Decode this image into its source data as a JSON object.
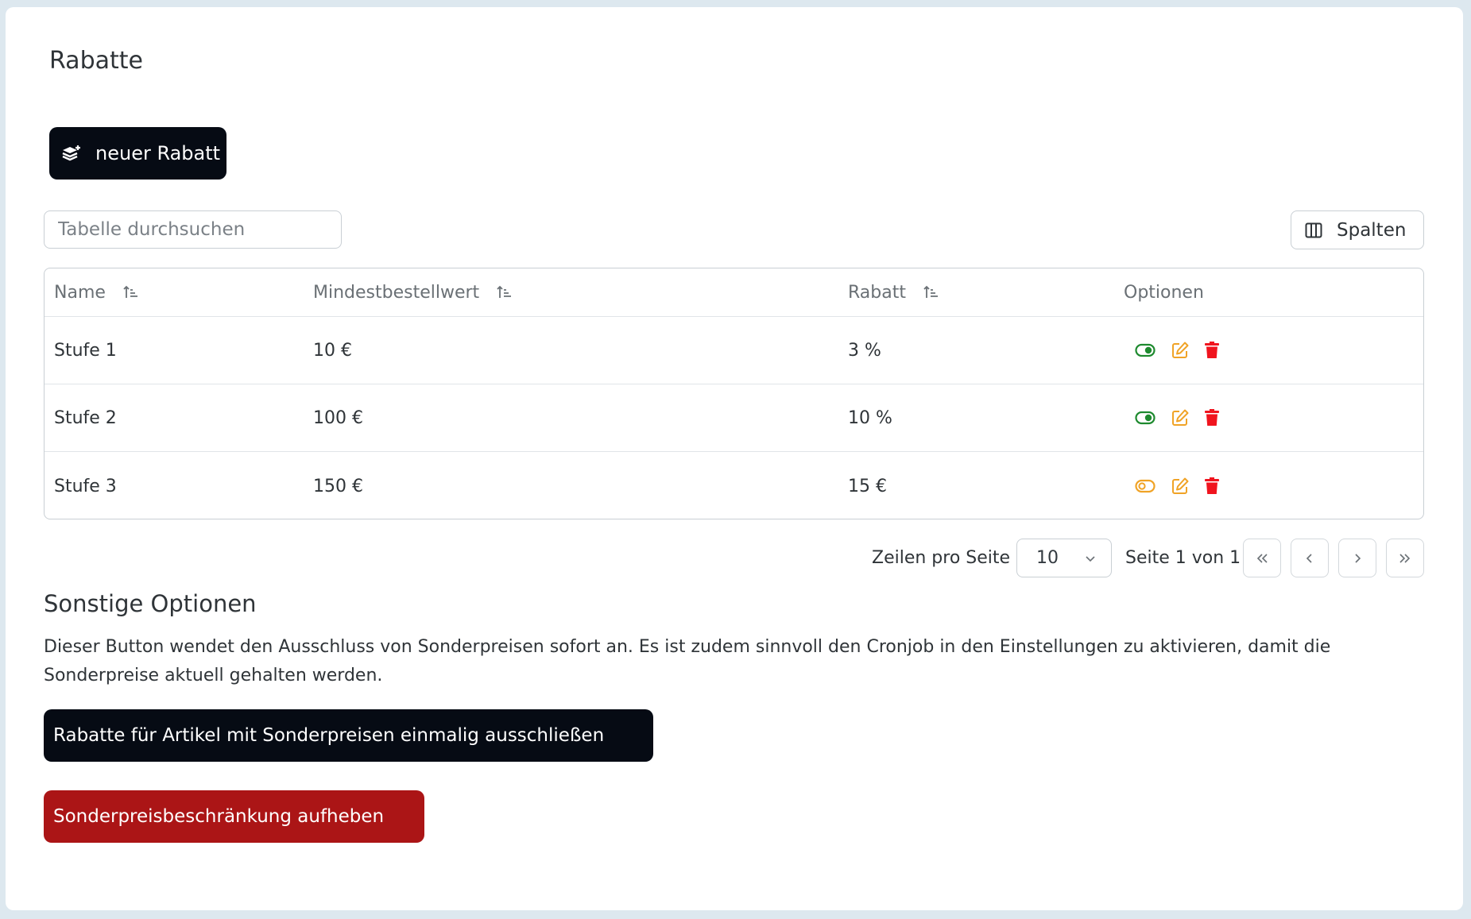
{
  "page": {
    "title": "Rabatte"
  },
  "toolbar": {
    "new_label": "neuer Rabatt",
    "columns_label": "Spalten"
  },
  "search": {
    "placeholder": "Tabelle durchsuchen",
    "value": ""
  },
  "table": {
    "headers": [
      "Name",
      "Mindestbestellwert",
      "Rabatt",
      "Optionen"
    ],
    "rows": [
      {
        "name": "Stufe 1",
        "min_order": "10 €",
        "discount": "3 %",
        "active": true
      },
      {
        "name": "Stufe 2",
        "min_order": "100 €",
        "discount": "10 %",
        "active": true
      },
      {
        "name": "Stufe 3",
        "min_order": "150 €",
        "discount": "15 €",
        "active": false
      }
    ]
  },
  "pagination": {
    "rows_label": "Zeilen pro Seite",
    "rows_value": "10",
    "page_info": "Seite 1 von 1"
  },
  "other": {
    "title": "Sonstige Optionen",
    "description": "Dieser Button wendet den Ausschluss von Sonderpreisen sofort an. Es ist zudem sinnvoll den Cronjob in den Einstellungen zu aktivieren, damit die Sonderpreise aktuell gehalten werden.",
    "exclude_label": "Rabatte für Artikel mit Sonderpreisen einmalig ausschließen",
    "lift_label": "Sonderpreisbeschränkung aufheben"
  },
  "colors": {
    "primary_button": "#060b14",
    "danger_button": "#ab1516",
    "toggle_on": "#1e8a2f",
    "toggle_off": "#f0a326",
    "edit": "#f0a326",
    "delete": "#f0141e"
  },
  "icons": {
    "new": "layers-plus-icon",
    "columns": "columns-icon",
    "sort": "sort-ascending-icon",
    "toggle": "toggle-icon",
    "edit": "edit-icon",
    "delete": "trash-icon",
    "first": "chevrons-left-icon",
    "prev": "chevron-left-icon",
    "next": "chevron-right-icon",
    "last": "chevrons-right-icon"
  }
}
